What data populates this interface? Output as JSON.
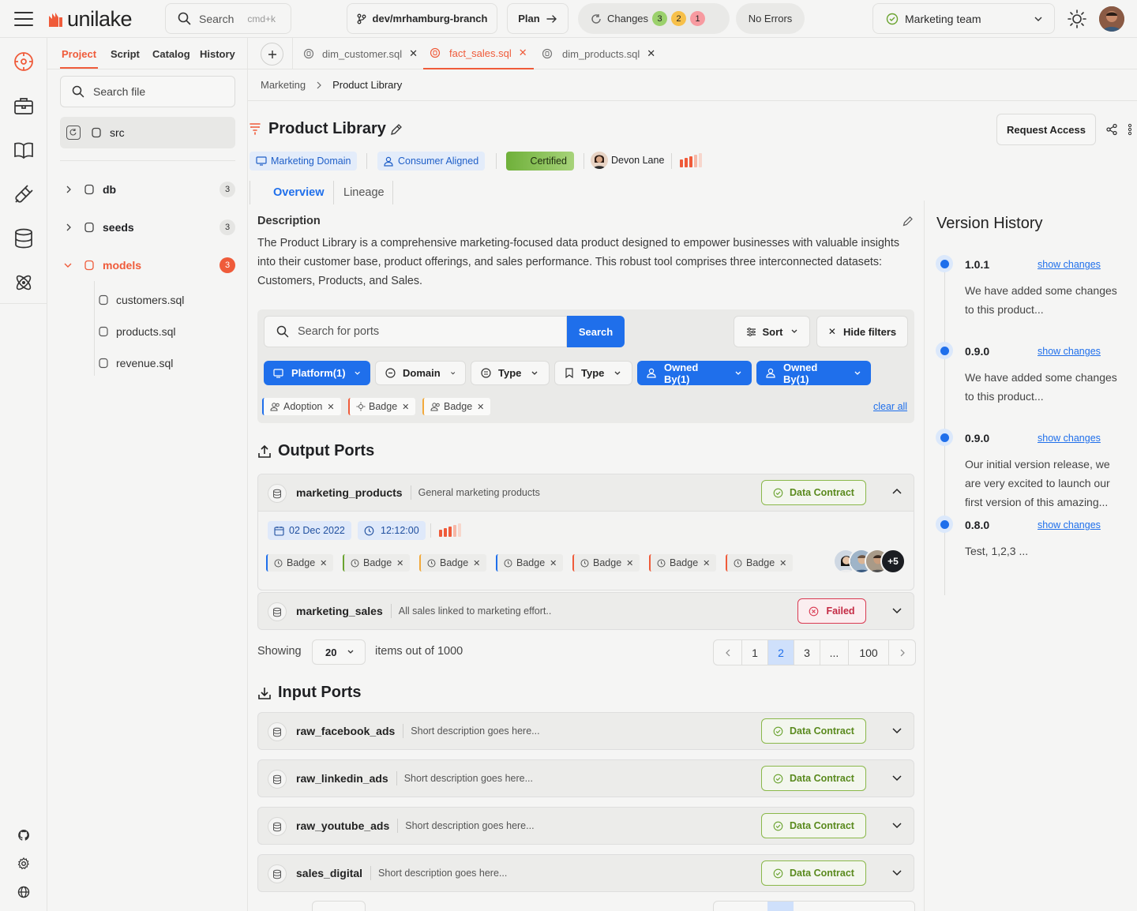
{
  "app": {
    "name": "unilake"
  },
  "header": {
    "search_label": "Search",
    "search_shortcut": "cmd+k",
    "branch": "dev/mrhamburg-branch",
    "plan_label": "Plan",
    "changes_label": "Changes",
    "changes_counts": [
      "3",
      "2",
      "1"
    ],
    "errors_label": "No Errors",
    "team": "Marketing team"
  },
  "rail": {
    "icons": [
      "compass-icon",
      "briefcase-icon",
      "book-icon",
      "plug-icon",
      "database-icon",
      "atom-icon",
      "github-icon",
      "settings-icon",
      "globe-icon"
    ]
  },
  "file_panel": {
    "tabs": [
      "Project",
      "Script",
      "Catalog",
      "History"
    ],
    "search_placeholder": "Search file",
    "root": "src",
    "folders": [
      {
        "name": "db",
        "count": "3"
      },
      {
        "name": "seeds",
        "count": "3"
      },
      {
        "name": "models",
        "count": "3"
      }
    ],
    "files": [
      "customers.sql",
      "products.sql",
      "revenue.sql"
    ]
  },
  "editor_tabs": [
    "dim_customer.sql",
    "fact_sales.sql",
    "dim_products.sql"
  ],
  "breadcrumb": [
    "Marketing",
    "Product Library"
  ],
  "product": {
    "title": "Product Library",
    "request_access": "Request Access",
    "chips": [
      "Marketing Domain",
      "Consumer Aligned",
      "Certified"
    ],
    "owner": "Devon Lane",
    "tabs": [
      "Overview",
      "Lineage"
    ],
    "description_label": "Description",
    "description": "The Product Library is a comprehensive marketing-focused data product  designed to empower businesses with valuable insights into their  customer base, product offerings, and sales performance. This robust  tool comprises three interconnected datasets: Customers, Products, and  Sales."
  },
  "filters": {
    "search_placeholder": "Search for ports",
    "search_button": "Search",
    "sort": "Sort",
    "hide_filters": "Hide filters",
    "buttons": [
      "Platform(1)",
      "Domain",
      "Type",
      "Type",
      "Owned By(1)",
      "Owned By(1)"
    ],
    "active_tags": [
      "Adoption",
      "Badge",
      "Badge"
    ],
    "clear_all": "clear all"
  },
  "output_ports": {
    "title": "Output Ports",
    "rows": [
      {
        "name": "marketing_products",
        "desc": "General marketing products",
        "status": "Data Contract"
      },
      {
        "name": "marketing_sales",
        "desc": "All sales linked to marketing effort..",
        "status": "Failed"
      }
    ],
    "expanded": {
      "date": "02 Dec 2022",
      "time": "12:12:00",
      "badges": [
        "Badge",
        "Badge",
        "Badge",
        "Badge",
        "Badge",
        "Badge",
        "Badge"
      ],
      "more_avatars": "+5"
    }
  },
  "pagination": {
    "showing": "Showing",
    "page_size": "20",
    "summary": "items out of 1000",
    "pages": [
      "1",
      "2",
      "3",
      "...",
      "100"
    ],
    "current": "2"
  },
  "input_ports": {
    "title": "Input Ports",
    "rows": [
      {
        "name": "raw_facebook_ads",
        "desc": "Short description goes here...",
        "status": "Data Contract"
      },
      {
        "name": "raw_linkedin_ads",
        "desc": "Short description goes here...",
        "status": "Data Contract"
      },
      {
        "name": "raw_youtube_ads",
        "desc": "Short description goes here...",
        "status": "Data Contract"
      },
      {
        "name": "sales_digital",
        "desc": "Short description goes here...",
        "status": "Data Contract"
      }
    ]
  },
  "version_history": {
    "title": "Version History",
    "link_label": "show changes",
    "items": [
      {
        "version": "1.0.1",
        "text": "We have added some changes to this product..."
      },
      {
        "version": "0.9.0",
        "text": "We have added some changes to this product..."
      },
      {
        "version": "0.9.0",
        "text": "Our initial version release, we are very excited to launch our first version of this amazing..."
      },
      {
        "version": "0.8.0",
        "text": "Test, 1,2,3 ..."
      }
    ]
  },
  "colors": {
    "accent": "#1f6feb",
    "brand": "#ef5b3a",
    "green": "#6aa32f",
    "red": "#d93a52"
  }
}
